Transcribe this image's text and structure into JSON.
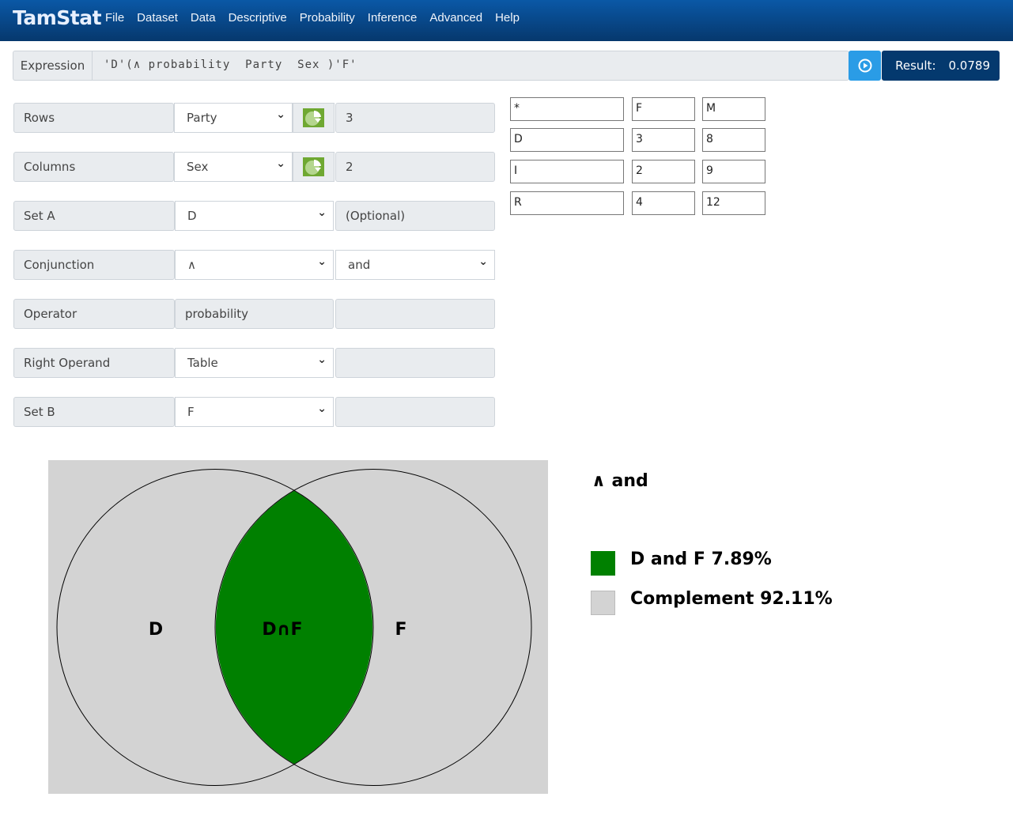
{
  "header": {
    "logo": "TamStat",
    "menu": [
      "File",
      "Dataset",
      "Data",
      "Descriptive",
      "Probability",
      "Inference",
      "Advanced",
      "Help"
    ]
  },
  "expression": {
    "label": "Expression",
    "value": "'D'(∧ probability  Party  Sex )'F'",
    "run_icon": "play-circle-icon",
    "result_label": "Result:",
    "result_value": "0.0789"
  },
  "form": {
    "rows": {
      "label": "Rows",
      "value": "Party",
      "count": "3",
      "icon": "pie-chart-icon"
    },
    "columns": {
      "label": "Columns",
      "value": "Sex",
      "count": "2",
      "icon": "pie-chart-icon"
    },
    "setA": {
      "label": "Set A",
      "value": "D",
      "extra": "(Optional)"
    },
    "conjunction": {
      "label": "Conjunction",
      "value": "∧",
      "word": "and"
    },
    "operator": {
      "label": "Operator",
      "value": "probability"
    },
    "rightOperand": {
      "label": "Right Operand",
      "value": "Table"
    },
    "setB": {
      "label": "Set B",
      "value": "F"
    }
  },
  "table": [
    [
      "*",
      "F",
      "M"
    ],
    [
      "D",
      "3",
      "8"
    ],
    [
      "I",
      "2",
      "9"
    ],
    [
      "R",
      "4",
      "12"
    ]
  ],
  "venn": {
    "left": "D",
    "intersection": "D∩F",
    "right": "F",
    "colors": {
      "intersection": "#008000",
      "background": "#d3d3d3"
    }
  },
  "legend": {
    "title": "∧ and",
    "items": [
      {
        "label": "D and F 7.89%",
        "color": "#008000"
      },
      {
        "label": "Complement 92.11%",
        "color": "#d3d3d3"
      }
    ]
  }
}
